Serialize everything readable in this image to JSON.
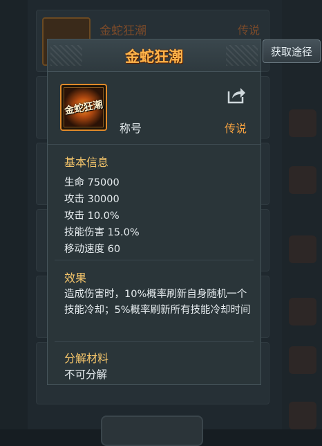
{
  "background": {
    "row_title": "金蛇狂潮",
    "row_rank": "传说"
  },
  "source_button": {
    "label": "获取途径"
  },
  "popup": {
    "title": "金蛇狂潮",
    "item_icon_text": "金蛇狂潮",
    "item_type": "称号",
    "item_rank": "传说",
    "share_icon": "share-icon",
    "basic_info": {
      "label": "基本信息",
      "stats": [
        "生命  75000",
        "攻击  30000",
        "攻击  10.0%",
        "技能伤害  15.0%",
        "移动速度  60"
      ]
    },
    "effect": {
      "label": "效果",
      "text": "造成伤害时，10%概率刷新自身随机一个技能冷却；5%概率刷新所有技能冷却时间"
    },
    "decompose": {
      "label": "分解材料",
      "value": "不可分解"
    }
  },
  "colors": {
    "title": "#ffb44a",
    "rank": "#f2a040",
    "section_label": "#f3c46a",
    "text": "#e6ecef"
  }
}
